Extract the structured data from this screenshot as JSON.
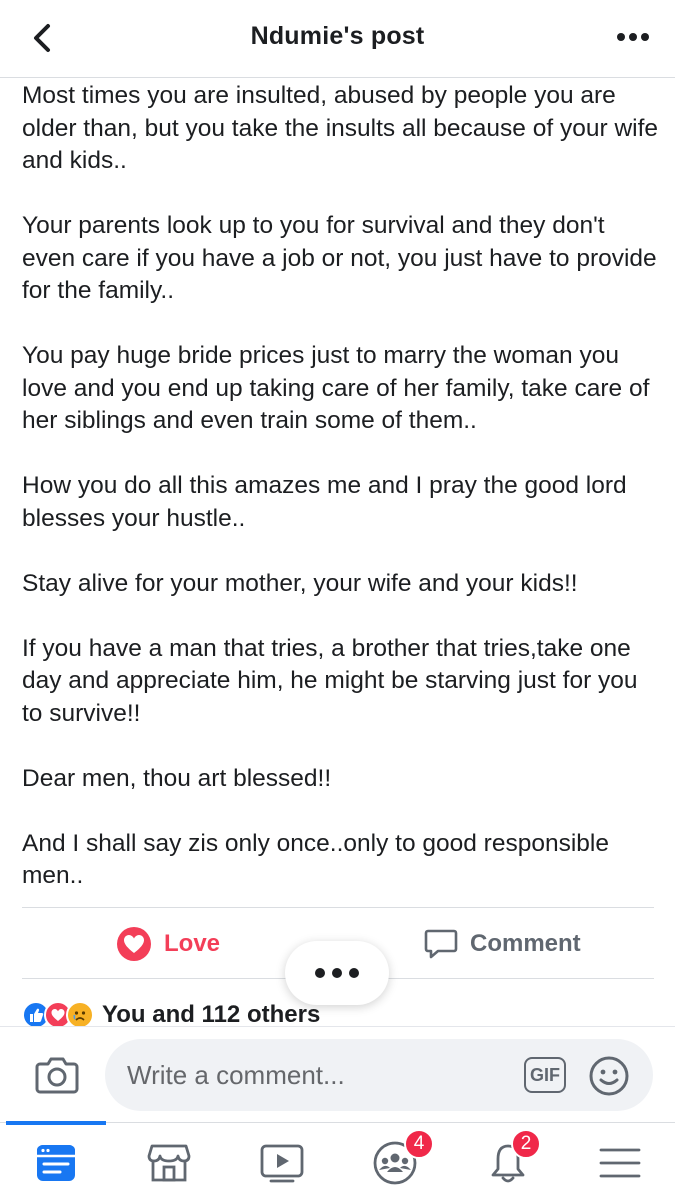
{
  "header": {
    "title": "Ndumie's post"
  },
  "post": {
    "paragraphs": [
      "Most times you are insulted, abused by people you are older than, but you take the insults all because of your wife and kids..",
      "Your parents look up to you for survival and they don't even care if you have a job or not, you just have to provide for the family..",
      "You pay huge bride prices just to marry the woman you love and you end up taking care of her family, take care of her siblings and even train some of them..",
      "How you do all this amazes me and I pray the good lord blesses your hustle..",
      "Stay alive for your mother, your wife and your kids!!",
      "If you have a man that tries, a brother that tries,take one day and appreciate him, he might be starving just for you to survive!!",
      "Dear men, thou art blessed!!",
      "And I shall say zis only once..only to good responsible men.."
    ]
  },
  "actions": {
    "love_label": "Love",
    "comment_label": "Comment"
  },
  "reactions": {
    "summary": "You and 112 others"
  },
  "composer": {
    "placeholder": "Write a comment...",
    "gif_label": "GIF"
  },
  "tabbar": {
    "groups_badge": "4",
    "notifications_badge": "2"
  },
  "colors": {
    "accent": "#1877f2",
    "love": "#f33e58",
    "badge": "#f02849"
  }
}
